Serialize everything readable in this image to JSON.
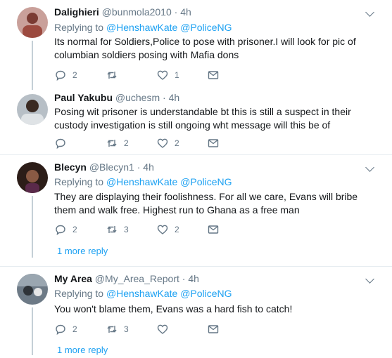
{
  "tweets": [
    {
      "display_name": "Dalighieri",
      "handle": "@bunmola2010",
      "time": "4h",
      "replying_label": "Replying to",
      "reply_to": [
        "@HenshawKate",
        "@PoliceNG"
      ],
      "text": "Its normal for Soldiers,Police to pose with prisoner.I will look for pic of columbian soldiers posing with Mafia dons",
      "reply_count": "2",
      "retweet_count": "",
      "like_count": "1"
    },
    {
      "display_name": "Paul Yakubu",
      "handle": "@uchesm",
      "time": "4h",
      "text": "Posing wit prisoner is understandable bt this is still a suspect in their custody investigation is still ongoing wht message will this be of",
      "reply_count": "",
      "retweet_count": "2",
      "like_count": "2"
    },
    {
      "display_name": "Blecyn",
      "handle": "@Blecyn1",
      "time": "4h",
      "replying_label": "Replying to",
      "reply_to": [
        "@HenshawKate",
        "@PoliceNG"
      ],
      "text": "They are displaying their foolishness. For all we care, Evans will bribe them and walk free. Highest run to Ghana as a free man",
      "reply_count": "2",
      "retweet_count": "3",
      "like_count": "2",
      "more_replies": "1 more reply"
    },
    {
      "display_name": "My Area",
      "handle": "@My_Area_Report",
      "time": "4h",
      "replying_label": "Replying to",
      "reply_to": [
        "@HenshawKate",
        "@PoliceNG"
      ],
      "text": "You won't blame them, Evans was a hard fish to catch!",
      "reply_count": "2",
      "retweet_count": "3",
      "like_count": "",
      "more_replies": "1 more reply"
    }
  ],
  "colors": {
    "link": "#1da1f2",
    "muted": "#657786",
    "text": "#14171a",
    "divider": "#e6ecf0"
  },
  "icons": [
    "reply-icon",
    "retweet-icon",
    "like-icon",
    "direct-message-icon",
    "chevron-down-icon"
  ]
}
